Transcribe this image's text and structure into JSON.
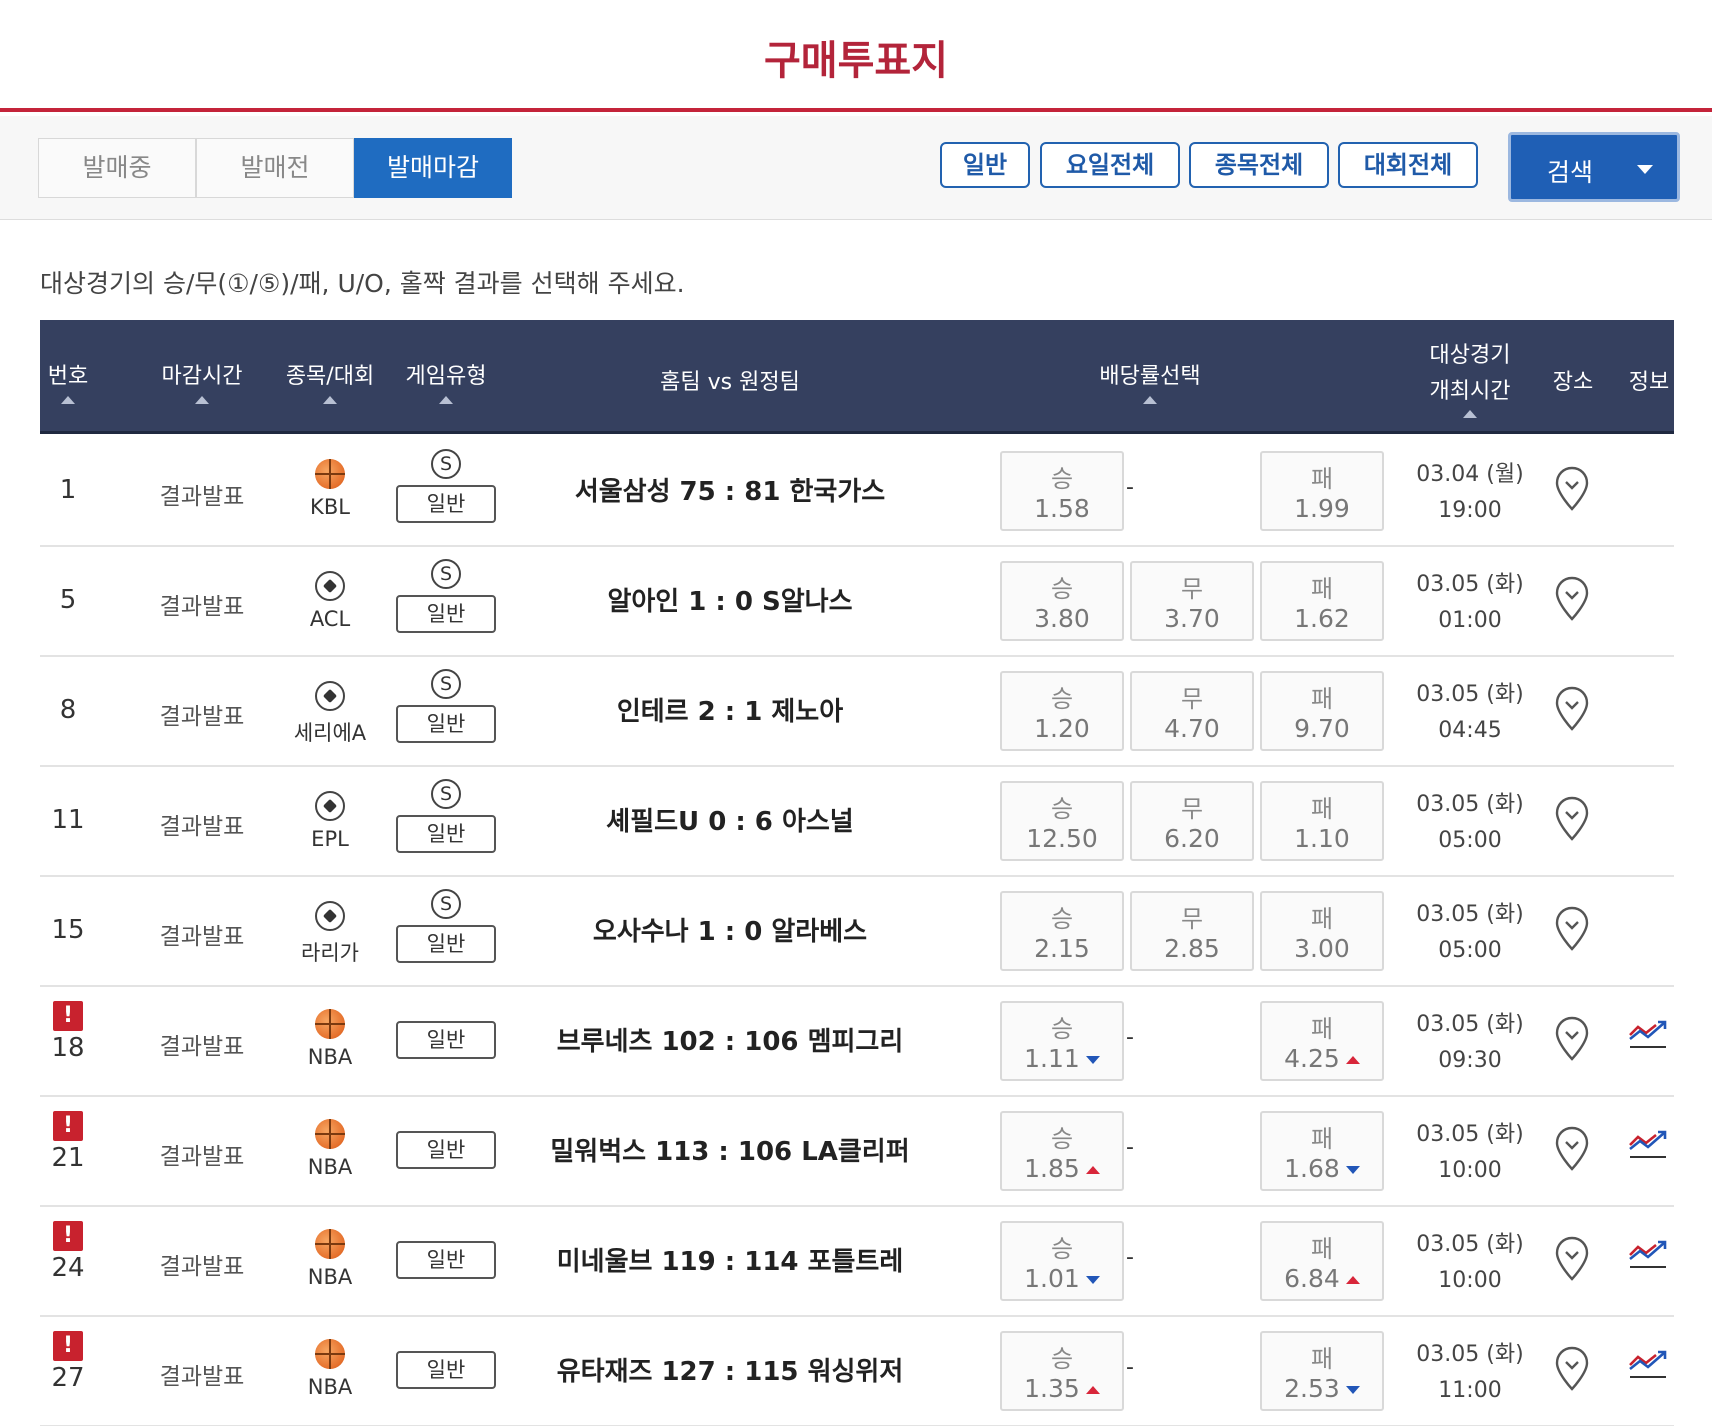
{
  "header": {
    "title": "구매투표지"
  },
  "tabs": [
    {
      "label": "발매중",
      "active": false
    },
    {
      "label": "발매전",
      "active": false
    },
    {
      "label": "발매마감",
      "active": true
    }
  ],
  "filters": {
    "general": "일반",
    "day": "요일전체",
    "sport": "종목전체",
    "league": "대회전체",
    "search": "검색"
  },
  "instruction": "대상경기의 승/무(①/⑤)/패, U/O, 홀짝 결과를 선택해 주세요.",
  "columns": {
    "num": "번호",
    "deadline": "마감시간",
    "sport": "종목/대회",
    "gametype": "게임유형",
    "teams": "홈팀 vs 원정팀",
    "odds": "배당률선택",
    "datetime_1": "대상경기",
    "datetime_2": "개최시간",
    "venue": "장소",
    "info": "정보"
  },
  "rows": [
    {
      "num": "1",
      "warn": false,
      "status": "결과발표",
      "sport": "basketball",
      "league": "KBL",
      "s": "S",
      "gtype": "일반",
      "match": "서울삼성 75 : 81 한국가스",
      "win": {
        "label": "승",
        "value": "1.58",
        "trend": ""
      },
      "draw": null,
      "lose": {
        "label": "패",
        "value": "1.99",
        "trend": ""
      },
      "date": "03.04 (월)",
      "time": "19:00",
      "chart": false
    },
    {
      "num": "5",
      "warn": false,
      "status": "결과발표",
      "sport": "soccer",
      "league": "ACL",
      "s": "S",
      "gtype": "일반",
      "match": "알아인 1 : 0 S알나스",
      "win": {
        "label": "승",
        "value": "3.80",
        "trend": ""
      },
      "draw": {
        "label": "무",
        "value": "3.70",
        "trend": ""
      },
      "lose": {
        "label": "패",
        "value": "1.62",
        "trend": ""
      },
      "date": "03.05 (화)",
      "time": "01:00",
      "chart": false
    },
    {
      "num": "8",
      "warn": false,
      "status": "결과발표",
      "sport": "soccer",
      "league": "세리에A",
      "s": "S",
      "gtype": "일반",
      "match": "인테르 2 : 1 제노아",
      "win": {
        "label": "승",
        "value": "1.20",
        "trend": ""
      },
      "draw": {
        "label": "무",
        "value": "4.70",
        "trend": ""
      },
      "lose": {
        "label": "패",
        "value": "9.70",
        "trend": ""
      },
      "date": "03.05 (화)",
      "time": "04:45",
      "chart": false
    },
    {
      "num": "11",
      "warn": false,
      "status": "결과발표",
      "sport": "soccer",
      "league": "EPL",
      "s": "S",
      "gtype": "일반",
      "match": "셰필드U 0 : 6 아스널",
      "win": {
        "label": "승",
        "value": "12.50",
        "trend": ""
      },
      "draw": {
        "label": "무",
        "value": "6.20",
        "trend": ""
      },
      "lose": {
        "label": "패",
        "value": "1.10",
        "trend": ""
      },
      "date": "03.05 (화)",
      "time": "05:00",
      "chart": false
    },
    {
      "num": "15",
      "warn": false,
      "status": "결과발표",
      "sport": "soccer",
      "league": "라리가",
      "s": "S",
      "gtype": "일반",
      "match": "오사수나 1 : 0 알라베스",
      "win": {
        "label": "승",
        "value": "2.15",
        "trend": ""
      },
      "draw": {
        "label": "무",
        "value": "2.85",
        "trend": ""
      },
      "lose": {
        "label": "패",
        "value": "3.00",
        "trend": ""
      },
      "date": "03.05 (화)",
      "time": "05:00",
      "chart": false
    },
    {
      "num": "18",
      "warn": true,
      "status": "결과발표",
      "sport": "basketball",
      "league": "NBA",
      "s": "",
      "gtype": "일반",
      "match": "브루네츠 102 : 106 멤피그리",
      "win": {
        "label": "승",
        "value": "1.11",
        "trend": "down"
      },
      "draw": null,
      "lose": {
        "label": "패",
        "value": "4.25",
        "trend": "up"
      },
      "date": "03.05 (화)",
      "time": "09:30",
      "chart": true
    },
    {
      "num": "21",
      "warn": true,
      "status": "결과발표",
      "sport": "basketball",
      "league": "NBA",
      "s": "",
      "gtype": "일반",
      "match": "밀워벅스 113 : 106 LA클리퍼",
      "win": {
        "label": "승",
        "value": "1.85",
        "trend": "up"
      },
      "draw": null,
      "lose": {
        "label": "패",
        "value": "1.68",
        "trend": "down"
      },
      "date": "03.05 (화)",
      "time": "10:00",
      "chart": true
    },
    {
      "num": "24",
      "warn": true,
      "status": "결과발표",
      "sport": "basketball",
      "league": "NBA",
      "s": "",
      "gtype": "일반",
      "match": "미네울브 119 : 114 포틀트레",
      "win": {
        "label": "승",
        "value": "1.01",
        "trend": "down"
      },
      "draw": null,
      "lose": {
        "label": "패",
        "value": "6.84",
        "trend": "up"
      },
      "date": "03.05 (화)",
      "time": "10:00",
      "chart": true
    },
    {
      "num": "27",
      "warn": true,
      "status": "결과발표",
      "sport": "basketball",
      "league": "NBA",
      "s": "",
      "gtype": "일반",
      "match": "유타재즈 127 : 115 워싱위저",
      "win": {
        "label": "승",
        "value": "1.35",
        "trend": "up"
      },
      "draw": null,
      "lose": {
        "label": "패",
        "value": "2.53",
        "trend": "down"
      },
      "date": "03.05 (화)",
      "time": "11:00",
      "chart": true
    }
  ],
  "dash": "-",
  "warn_symbol": "!",
  "colors": {
    "brand_red": "#b3243a",
    "header_bg": "#35405f",
    "active_blue": "#1f6cc1",
    "up": "#d8263a",
    "down": "#2156b8"
  }
}
